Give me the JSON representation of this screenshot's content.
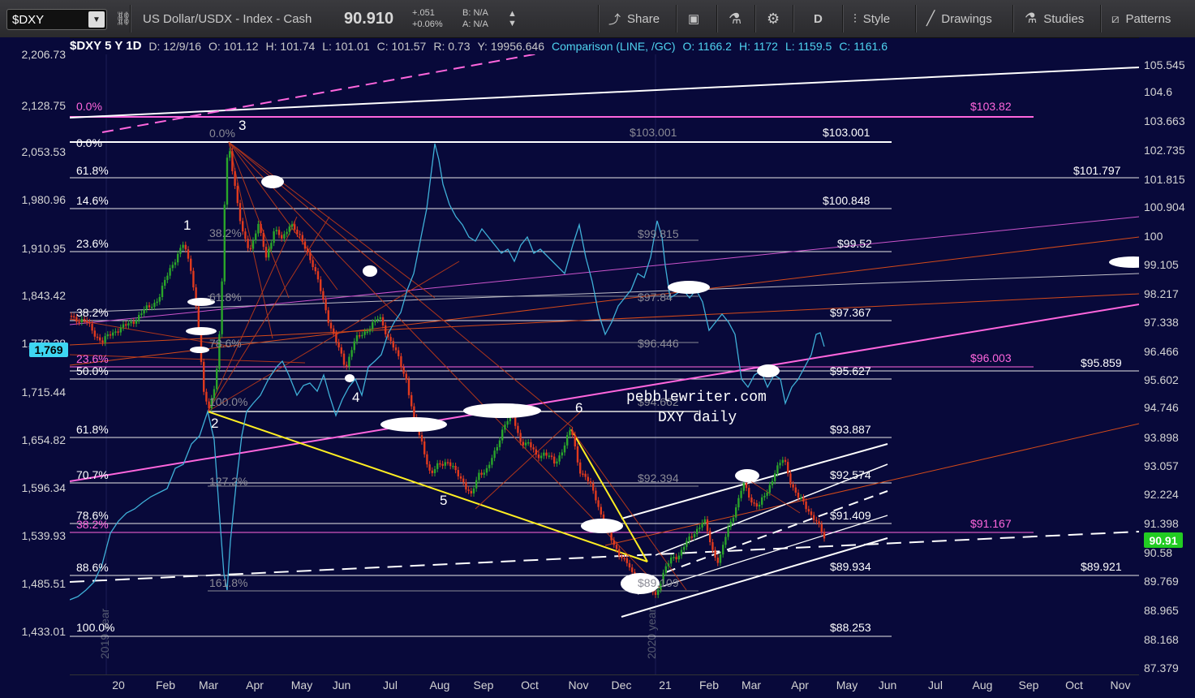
{
  "toolbar": {
    "symbol": "$DXY",
    "description": "US Dollar/USDX - Index - Cash",
    "last_price": "90.910",
    "change": "+.051",
    "change_pct": "+0.06%",
    "bid": "B: N/A",
    "ask": "A: N/A",
    "share_label": "Share",
    "interval": "D",
    "style_label": "Style",
    "drawings_label": "Drawings",
    "studies_label": "Studies",
    "patterns_label": "Patterns"
  },
  "info": {
    "title": "$DXY 5 Y 1D",
    "date": "D: 12/9/16",
    "open": "O: 101.12",
    "high": "H: 101.74",
    "low": "L: 101.01",
    "close": "C: 101.57",
    "range": "R: 0.73",
    "y": "Y: 19956.646",
    "comparison": "Comparison (LINE, /GC)",
    "cmp_open": "O: 1166.2",
    "cmp_high": "H: 1172",
    "cmp_low": "L: 1159.5",
    "cmp_close": "C: 1161.6"
  },
  "left_axis": [
    "2,206.73",
    "2,128.75",
    "2,053.53",
    "1,980.96",
    "1,910.95",
    "1,843.42",
    "1,778.28",
    "1,715.44",
    "1,654.82",
    "1,596.34",
    "1,539.93",
    "1,485.51",
    "1,433.01"
  ],
  "left_axis_marker": "1,769",
  "right_axis": [
    "105.545",
    "104.6",
    "103.663",
    "102.735",
    "101.815",
    "100.904",
    "100",
    "99.105",
    "98.217",
    "97.338",
    "96.466",
    "95.602",
    "94.746",
    "93.898",
    "93.057",
    "92.224",
    "91.398",
    "90.58",
    "89.769",
    "88.965",
    "88.168",
    "87.379"
  ],
  "right_axis_marker": "90.91",
  "x_axis": [
    "20",
    "Feb",
    "Mar",
    "Apr",
    "May",
    "Jun",
    "Jul",
    "Aug",
    "Sep",
    "Oct",
    "Nov",
    "Dec",
    "21",
    "Feb",
    "Mar",
    "Apr",
    "May",
    "Jun",
    "Jul",
    "Aug",
    "Sep",
    "Oct",
    "Nov"
  ],
  "annotations": {
    "watermark_1": "pebblewriter.com",
    "watermark_2": "DXY daily",
    "wave_labels": [
      "1",
      "2",
      "3",
      "4",
      "5",
      "6"
    ],
    "year_label_1": "2019 year",
    "year_label_2": "2020 year"
  },
  "fib_left": [
    "0.0%",
    "0.0%",
    "61.8%",
    "14.6%",
    "23.6%",
    "38.2%",
    "50.0%",
    "61.8%",
    "70.7%",
    "78.6%",
    "88.6%",
    "100.0%"
  ],
  "fib_gray": [
    "0.0%",
    "38.2%",
    "61.8%",
    "78.6%",
    "100.0%",
    "127.2%",
    "161.8%"
  ],
  "fib_pink": [
    "0.0%",
    "23.6%",
    "38.2%"
  ],
  "levels_white": [
    "$103.001",
    "$101.797",
    "$100.848",
    "$99.52",
    "$97.367",
    "$95.859",
    "$95.627",
    "$93.887",
    "$92.574",
    "$91.409",
    "$89.934",
    "$89.921",
    "$88.253"
  ],
  "levels_pink": [
    "$103.82",
    "$96.003",
    "$91.167"
  ],
  "levels_gray": [
    "$103.001",
    "$99.815",
    "$97.84",
    "$96.446",
    "$94.662",
    "$92.394",
    "$89.109"
  ],
  "colors": {
    "background": "#08093a",
    "price_up": "#2aa52a",
    "price_down": "#e03a1e",
    "gold_line": "#3fb0d8",
    "pink": "#ff66dd",
    "yellow": "#ffee22",
    "red_line": "#d44a1a"
  }
}
